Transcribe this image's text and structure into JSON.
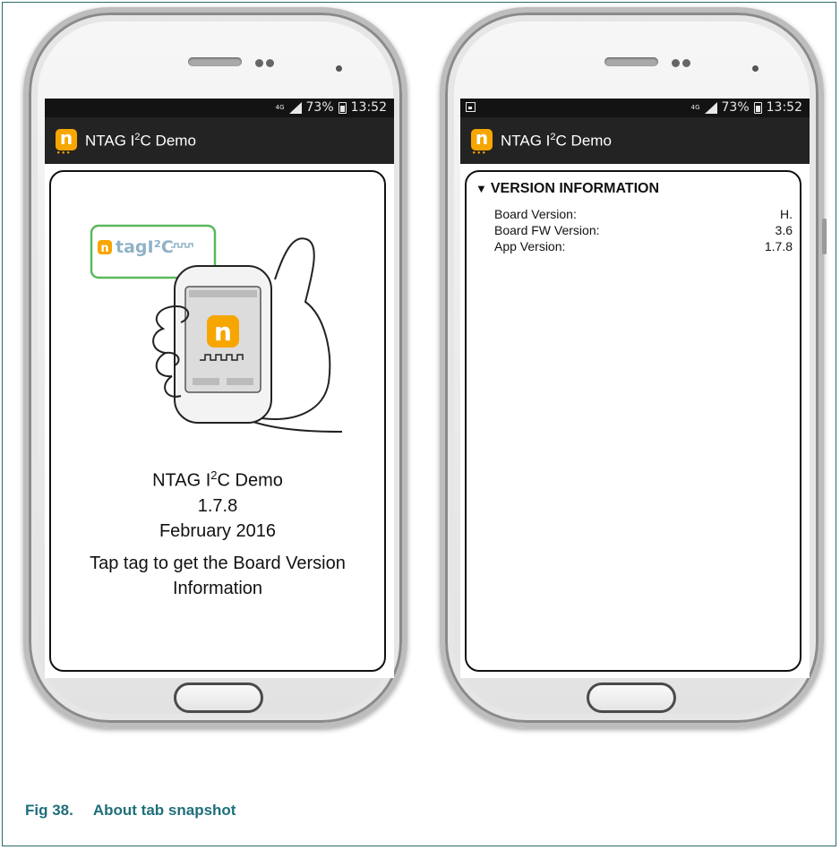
{
  "statusbar": {
    "network": "4G",
    "battery": "73%",
    "time": "13:52"
  },
  "app": {
    "title_pre": "NTAG I",
    "title_sup": "2",
    "title_post": "C Demo",
    "icon_letter": "n"
  },
  "about": {
    "illustration_logo": "tagI²C",
    "title_pre": "NTAG I",
    "title_sup": "2",
    "title_post": "C Demo",
    "version": "1.7.8",
    "date": "February 2016",
    "instruction_line1": "Tap tag to get the Board Version",
    "instruction_line2": "Information"
  },
  "version_info": {
    "header": "VERSION INFORMATION",
    "rows": [
      {
        "label": "Board Version:",
        "value": "H."
      },
      {
        "label": "Board FW Version:",
        "value": "3.6"
      },
      {
        "label": "App Version:",
        "value": "1.7.8"
      }
    ]
  },
  "caption": {
    "number": "Fig 38.",
    "text": "About tab snapshot"
  },
  "colors": {
    "accent": "#f7a600",
    "caption": "#1f6f7a",
    "statusbar": "#131313",
    "actionbar": "#232323"
  }
}
